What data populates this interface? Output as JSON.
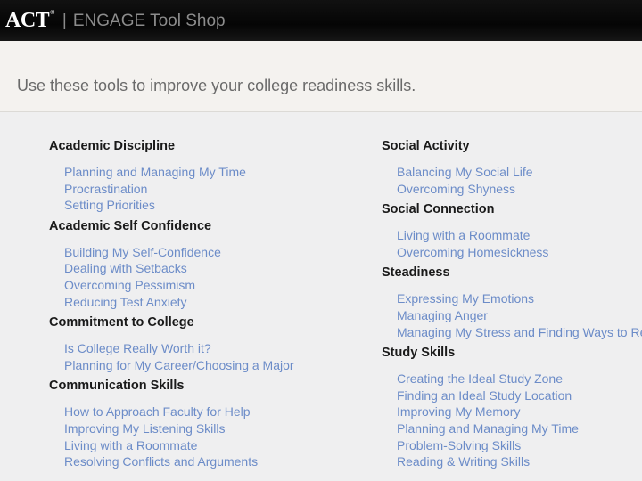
{
  "header": {
    "logo_text": "ACT",
    "logo_mark": "®",
    "separator": "|",
    "title": "ENGAGE Tool Shop"
  },
  "tagline": "Use these tools to improve your college readiness skills.",
  "left_column": [
    {
      "title": "Academic Discipline",
      "links": [
        "Planning and Managing My Time",
        "Procrastination",
        "Setting Priorities"
      ]
    },
    {
      "title": "Academic Self Confidence",
      "links": [
        "Building My Self-Confidence",
        "Dealing with Setbacks",
        "Overcoming Pessimism",
        "Reducing Test Anxiety"
      ]
    },
    {
      "title": "Commitment to College",
      "links": [
        "Is College Really Worth it?",
        "Planning for My Career/Choosing a Major"
      ]
    },
    {
      "title": "Communication Skills",
      "links": [
        "How to Approach Faculty for Help",
        "Improving My Listening Skills",
        "Living with a Roommate",
        "Resolving Conflicts and Arguments"
      ]
    }
  ],
  "right_column": [
    {
      "title": "Social Activity",
      "links": [
        "Balancing My Social Life",
        "Overcoming Shyness"
      ]
    },
    {
      "title": "Social Connection",
      "links": [
        "Living with a Roommate",
        "Overcoming Homesickness"
      ]
    },
    {
      "title": "Steadiness",
      "links": [
        "Expressing My Emotions",
        "Managing Anger",
        "Managing My Stress and Finding Ways to Relax"
      ]
    },
    {
      "title": "Study Skills",
      "links": [
        "Creating the Ideal Study Zone",
        "Finding an Ideal Study Location",
        "Improving My Memory",
        "Planning and Managing My Time",
        "Problem-Solving Skills",
        "Reading & Writing Skills"
      ]
    }
  ],
  "colors": {
    "link": "#6c8cc8",
    "heading": "#1a1a1a",
    "header_bg": "#0a0a0a",
    "page_bg": "#efeff0"
  }
}
